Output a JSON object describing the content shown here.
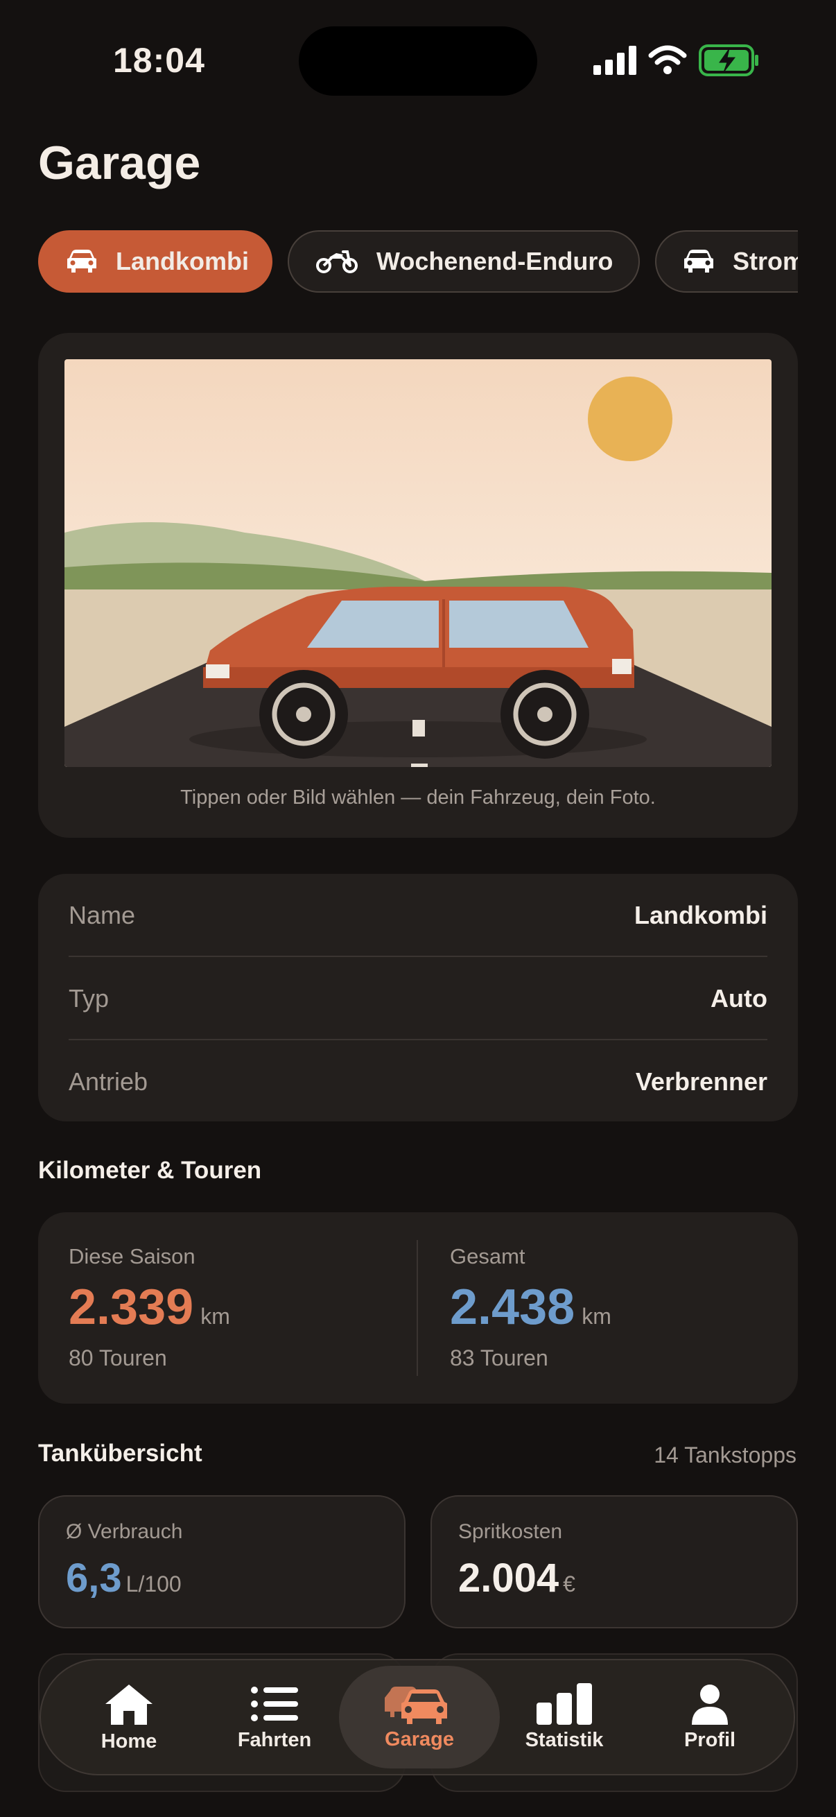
{
  "status": {
    "time": "18:04"
  },
  "page": {
    "title": "Garage"
  },
  "vehicles": [
    {
      "label": "Landkombi",
      "icon": "car-icon",
      "active": true
    },
    {
      "label": "Wochenend-Enduro",
      "icon": "motorcycle-icon",
      "active": false
    },
    {
      "label": "Strom",
      "icon": "car-icon",
      "active": false
    }
  ],
  "photo": {
    "caption": "Tippen oder Bild wählen — dein Fahrzeug, dein Foto."
  },
  "details": [
    {
      "label": "Name",
      "value": "Landkombi"
    },
    {
      "label": "Typ",
      "value": "Auto"
    },
    {
      "label": "Antrieb",
      "value": "Verbrenner"
    }
  ],
  "km": {
    "title": "Kilometer & Touren",
    "season": {
      "label": "Diese Saison",
      "value": "2.339",
      "unit": "km",
      "tours": "80 Touren"
    },
    "total": {
      "label": "Gesamt",
      "value": "2.438",
      "unit": "km",
      "tours": "83 Touren"
    }
  },
  "fuel": {
    "title": "Tankübersicht",
    "stops": "14 Tankstopps",
    "consumption": {
      "label": "Ø Verbrauch",
      "value": "6,3",
      "unit": "L/100"
    },
    "costs": {
      "label": "Spritkosten",
      "value": "2.004",
      "unit": "€"
    }
  },
  "tabs": [
    {
      "label": "Home",
      "icon": "home-icon"
    },
    {
      "label": "Fahrten",
      "icon": "list-icon"
    },
    {
      "label": "Garage",
      "icon": "garage-icon",
      "active": true
    },
    {
      "label": "Statistik",
      "icon": "bar-chart-icon"
    },
    {
      "label": "Profil",
      "icon": "person-icon"
    }
  ],
  "colors": {
    "accent": "#c65a36",
    "season_value": "#e47c54",
    "total_value": "#6e9ccc",
    "active_tab": "#f08a5f"
  }
}
